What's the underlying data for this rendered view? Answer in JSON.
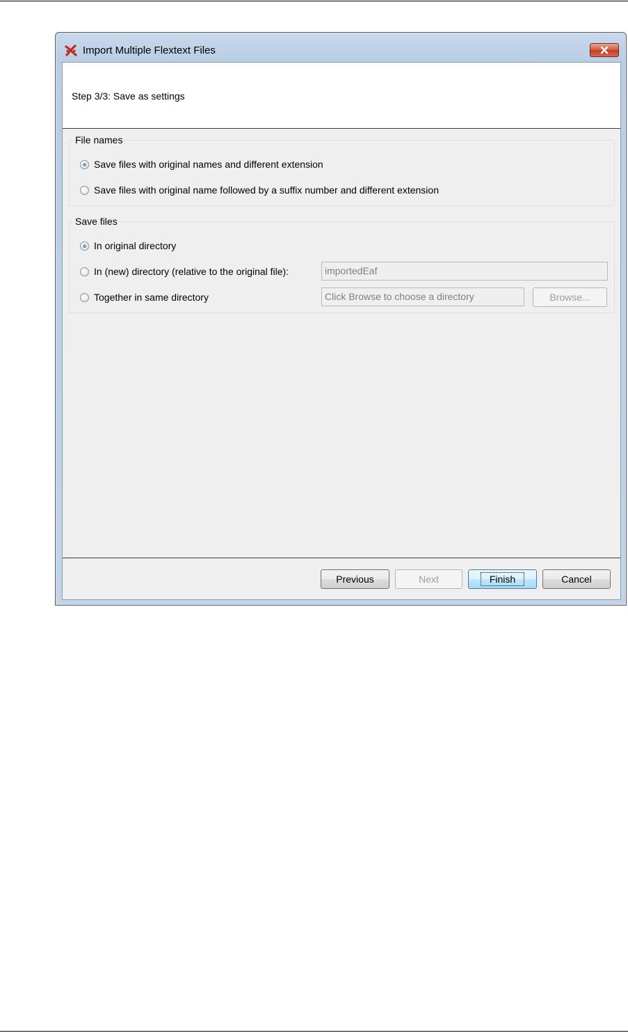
{
  "window": {
    "title": "Import Multiple Flextext Files",
    "icon": "app-cross-icon",
    "close_icon": "close-icon",
    "accent_color": "#c23a22"
  },
  "header": {
    "step_text": "Step 3/3: Save as settings"
  },
  "file_names": {
    "legend": "File names",
    "options": [
      {
        "label": "Save files with original names and different extension",
        "checked": true
      },
      {
        "label": "Save files with original name followed by a suffix number and different extension",
        "checked": false
      }
    ]
  },
  "save_files": {
    "legend": "Save files",
    "options": [
      {
        "label": "In original directory",
        "checked": true
      },
      {
        "label": "In (new) directory (relative to the original file):",
        "checked": false
      },
      {
        "label": "Together in same directory",
        "checked": false
      }
    ],
    "new_dir_value": "importedEaf",
    "same_dir_placeholder": "Click Browse to choose a directory",
    "browse_label": "Browse..."
  },
  "footer": {
    "previous_label": "Previous",
    "next_label": "Next",
    "finish_label": "Finish",
    "cancel_label": "Cancel"
  }
}
